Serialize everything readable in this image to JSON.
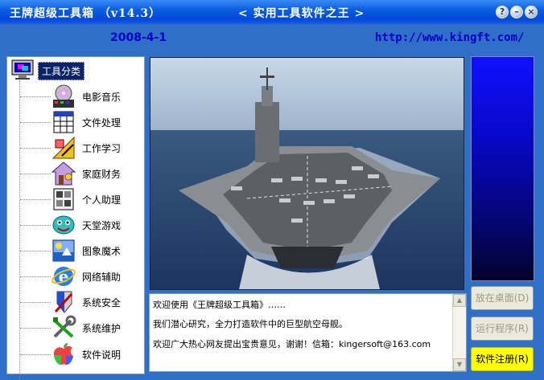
{
  "window": {
    "title": "王牌超级工具箱 （v14.3）",
    "subtitle": "< 实用工具软件之王 >",
    "controls": [
      "?",
      "–",
      "×"
    ]
  },
  "header": {
    "date": "2008-4-1",
    "url": "http://www.kingft.com/"
  },
  "tree": {
    "root_label": "工具分类",
    "items": [
      {
        "label": "电影音乐",
        "icon": "film-music-icon"
      },
      {
        "label": "文件处理",
        "icon": "file-processing-icon"
      },
      {
        "label": "工作学习",
        "icon": "work-study-icon"
      },
      {
        "label": "家庭财务",
        "icon": "home-finance-icon"
      },
      {
        "label": "个人助理",
        "icon": "personal-assistant-icon"
      },
      {
        "label": "天堂游戏",
        "icon": "games-icon"
      },
      {
        "label": "图象魔术",
        "icon": "image-magic-icon"
      },
      {
        "label": "网络辅助",
        "icon": "network-icon"
      },
      {
        "label": "系统安全",
        "icon": "system-security-icon"
      },
      {
        "label": "系统维护",
        "icon": "system-maintenance-icon"
      },
      {
        "label": "软件说明",
        "icon": "software-info-icon"
      }
    ]
  },
  "messages": [
    "欢迎使用《王牌超级工具箱》……",
    "我们潜心研究，全力打造软件中的巨型航空母舰。",
    "欢迎广大热心网友提出宝贵意见，谢谢！信箱：kingersoft@163.com"
  ],
  "buttons": {
    "place_desktop": "放在桌面(D)",
    "run_program": "运行程序(R)",
    "register": "软件注册(R)"
  },
  "colors": {
    "title_bar": "#0a5ee0",
    "window_bg": "#2f6fc8",
    "header_text": "#0000c8",
    "register_bg": "#ffff00"
  }
}
